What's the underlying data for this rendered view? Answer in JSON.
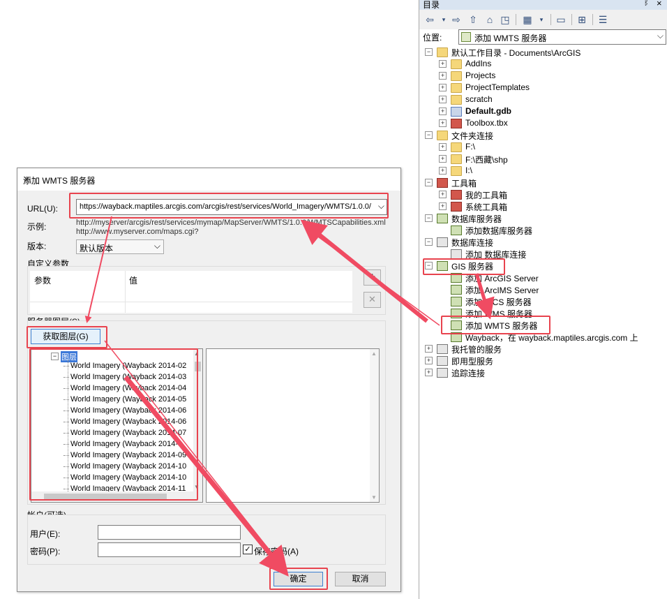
{
  "catalog": {
    "title": "目录",
    "pin": "ᛒ",
    "close": "×",
    "location_label": "位置:",
    "location_value": "添加 WMTS 服务器",
    "tree": [
      {
        "label": "默认工作目录 - Documents\\ArcGIS",
        "level": 0,
        "exp": "−",
        "icon": "home-folder-icon"
      },
      {
        "label": "AddIns",
        "level": 1,
        "exp": "+",
        "icon": "folder-icon"
      },
      {
        "label": "Projects",
        "level": 1,
        "exp": "+",
        "icon": "folder-icon"
      },
      {
        "label": "ProjectTemplates",
        "level": 1,
        "exp": "+",
        "icon": "folder-icon"
      },
      {
        "label": "scratch",
        "level": 1,
        "exp": "+",
        "icon": "folder-icon"
      },
      {
        "label": "Default.gdb",
        "level": 1,
        "exp": "+",
        "icon": "geodatabase-icon",
        "bold": true
      },
      {
        "label": "Toolbox.tbx",
        "level": 1,
        "exp": "+",
        "icon": "toolbox-icon"
      },
      {
        "label": "文件夹连接",
        "level": 0,
        "exp": "−",
        "icon": "folder-connection-icon"
      },
      {
        "label": "F:\\",
        "level": 1,
        "exp": "+",
        "icon": "folder-icon"
      },
      {
        "label": "F:\\西藏\\shp",
        "level": 1,
        "exp": "+",
        "icon": "folder-icon"
      },
      {
        "label": "I:\\",
        "level": 1,
        "exp": "+",
        "icon": "folder-icon"
      },
      {
        "label": "工具箱",
        "level": 0,
        "exp": "−",
        "icon": "toolboxes-icon"
      },
      {
        "label": "我的工具箱",
        "level": 1,
        "exp": "+",
        "icon": "toolbox-icon"
      },
      {
        "label": "系统工具箱",
        "level": 1,
        "exp": "+",
        "icon": "toolbox-icon"
      },
      {
        "label": "数据库服务器",
        "level": 0,
        "exp": "−",
        "icon": "database-server-icon"
      },
      {
        "label": "添加数据库服务器",
        "level": 1,
        "exp": "",
        "icon": "add-server-icon"
      },
      {
        "label": "数据库连接",
        "level": 0,
        "exp": "−",
        "icon": "database-connection-icon"
      },
      {
        "label": "添加 数据库连接",
        "level": 1,
        "exp": "",
        "icon": "add-connection-icon"
      },
      {
        "label": "GIS 服务器",
        "level": 0,
        "exp": "−",
        "icon": "gis-server-icon"
      },
      {
        "label": "添加 ArcGIS Server",
        "level": 1,
        "exp": "",
        "icon": "add-server-icon"
      },
      {
        "label": "添加 ArcIMS Server",
        "level": 1,
        "exp": "",
        "icon": "add-server-icon"
      },
      {
        "label": "添加 WCS 服务器",
        "level": 1,
        "exp": "",
        "icon": "add-server-icon"
      },
      {
        "label": "添加 WMS 服务器",
        "level": 1,
        "exp": "",
        "icon": "add-server-icon"
      },
      {
        "label": "添加 WMTS 服务器",
        "level": 1,
        "exp": "",
        "icon": "add-server-icon"
      },
      {
        "label": "Wayback，在 wayback.maptiles.arcgis.com 上",
        "level": 1,
        "exp": "",
        "icon": "wmts-server-icon"
      },
      {
        "label": "我托管的服务",
        "level": 0,
        "exp": "+",
        "icon": "hosted-services-icon"
      },
      {
        "label": "即用型服务",
        "level": 0,
        "exp": "+",
        "icon": "ready-services-icon"
      },
      {
        "label": "追踪连接",
        "level": 0,
        "exp": "+",
        "icon": "tracking-connection-icon"
      }
    ]
  },
  "dialog": {
    "title": "添加 WMTS 服务器",
    "close": "✕",
    "url_label": "URL(U):",
    "url_value": "https://wayback.maptiles.arcgis.com/arcgis/rest/services/World_Imagery/WMTS/1.0.0/",
    "example_label": "示例:",
    "example_line1": "http://myserver/arcgis/rest/services/mymap/MapServer/WMTS/1.0.0/WMTSCapabilities.xml",
    "example_line2": "http://www.myserver.com/maps.cgi?",
    "version_label": "版本:",
    "version_value": "默认版本",
    "custom_params_label": "自定义参数",
    "param_col": "参数",
    "value_col": "值",
    "server_layers_label": "服务器图层(S)",
    "get_layers_button": "获取图层(G)",
    "layers_root": "图层",
    "layers": [
      "World Imagery (Wayback 2014-02",
      "World Imagery (Wayback 2014-03",
      "World Imagery (Wayback 2014-04",
      "World Imagery (Wayback 2014-05",
      "World Imagery (Wayback 2014-06",
      "World Imagery (Wayback 2014-06",
      "World Imagery (Wayback 2014-07",
      "World Imagery (Wayback 2014-0",
      "World Imagery (Wayback 2014-09",
      "World Imagery (Wayback 2014-10",
      "World Imagery (Wayback 2014-10",
      "World Imagery (Wayback 2014-11"
    ],
    "account_label": "帐户(可选)",
    "user_label": "用户(E):",
    "password_label": "密码(P):",
    "save_password_label": "保存密码(A)",
    "ok_button": "确定",
    "cancel_button": "取消"
  },
  "colors": {
    "highlight": "#e8434e",
    "title_bar": "#d9e4f1",
    "dialog_bg": "#f0f0f0"
  }
}
